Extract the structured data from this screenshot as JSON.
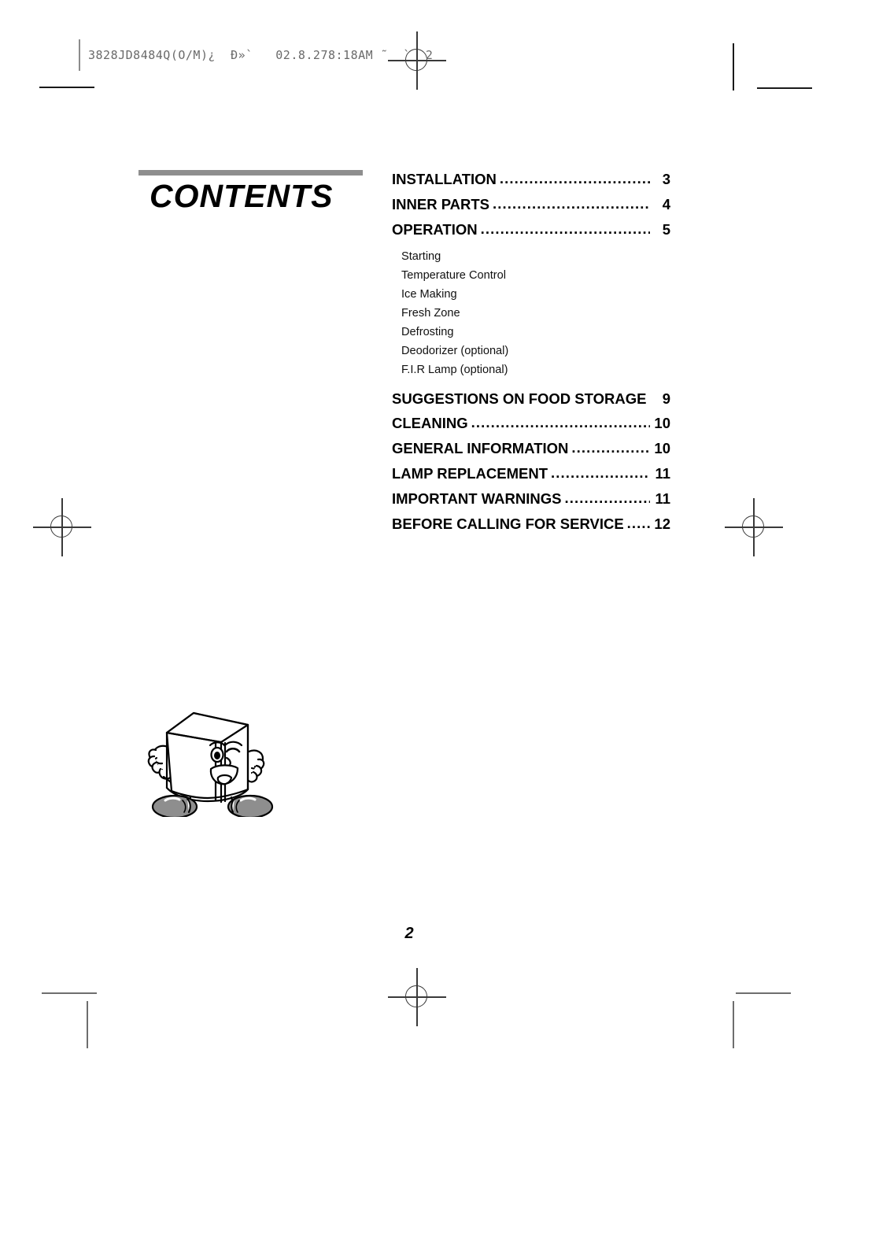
{
  "header": {
    "printer_code": "3828JD8484Q(O/M)¿  Ð»`   02.8.278:18AM ˜  `  2"
  },
  "contents": {
    "title": "CONTENTS"
  },
  "toc": {
    "entries": [
      {
        "label": "INSTALLATION",
        "page": "3"
      },
      {
        "label": "INNER PARTS",
        "page": "4"
      },
      {
        "label": "OPERATION",
        "page": "5"
      },
      {
        "label": "SUGGESTIONS ON FOOD STORAGE",
        "page": "9"
      },
      {
        "label": "CLEANING",
        "page": "10"
      },
      {
        "label": "GENERAL INFORMATION",
        "page": "10"
      },
      {
        "label": "LAMP REPLACEMENT",
        "page": "11"
      },
      {
        "label": "IMPORTANT WARNINGS",
        "page": "11"
      },
      {
        "label": "BEFORE CALLING FOR SERVICE",
        "page": "12"
      }
    ],
    "operation_subitems": [
      "Starting",
      "Temperature Control",
      "Ice Making",
      "Fresh Zone",
      "Defrosting",
      "Deodorizer (optional)",
      "F.I.R Lamp (optional)"
    ],
    "leader_dots": "...................................................................................."
  },
  "illustration": {
    "name": "refrigerator-mascot",
    "description": "Cartoon refrigerator character with winking face, waving arms and gray shoes",
    "body_color": "#ffffff",
    "outline_color": "#000000",
    "shoe_color": "#8e8e8e"
  },
  "footer": {
    "page_number": "2"
  },
  "marks": {
    "crop_mark_color": "#1a1a1a",
    "registration_mark_color": "#3a3a3a",
    "rule_color": "#8e8e8e"
  }
}
